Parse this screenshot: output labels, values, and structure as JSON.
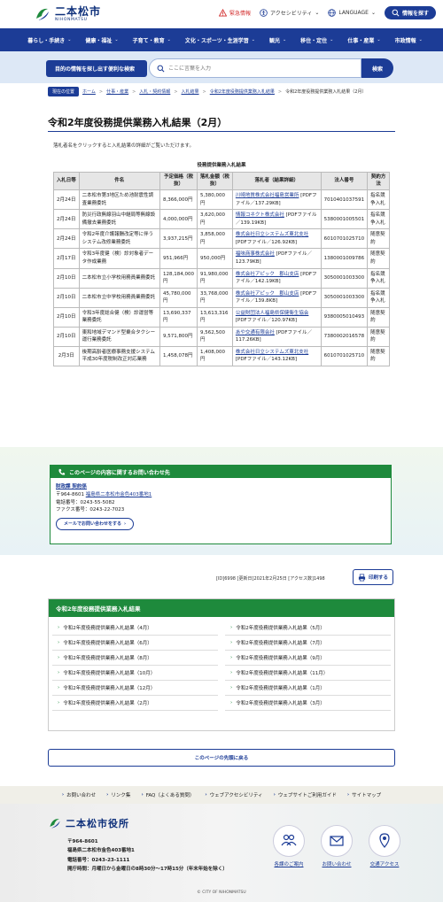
{
  "header": {
    "logo_ja": "二本松市",
    "logo_en": "NIHONMATSU",
    "emergency": "緊急情報",
    "accessibility": "アクセシビリティ",
    "language": "LANGUAGE",
    "info_search": "情報を探す"
  },
  "gnav": [
    {
      "label": "暮らし・手続き"
    },
    {
      "label": "健康・福祉"
    },
    {
      "label": "子育て・教育"
    },
    {
      "label": "文化・スポーツ・生涯学習"
    },
    {
      "label": "観光"
    },
    {
      "label": "移住・定住"
    },
    {
      "label": "仕事・産業"
    },
    {
      "label": "市政情報"
    }
  ],
  "search": {
    "label": "目的の情報を探し出す便利な検索",
    "placeholder": "ここに言葉を入力",
    "button": "検索"
  },
  "breadcrumb": {
    "here": "現在の位置",
    "items": [
      "ホーム",
      "仕事・産業",
      "入札・契約情報",
      "入札結果",
      "令和2年度役務提供業務入札結果"
    ],
    "current": "令和2年度役務提供業務入札結果（2月）"
  },
  "page": {
    "title": "令和2年度役務提供業務入札結果（2月）",
    "intro": "落札者名をクリックすると入札結果の詳細がご覧いただけます。"
  },
  "table": {
    "caption": "役務提供業務入札結果",
    "headers": [
      "入札日等",
      "件名",
      "予定価格（税抜）",
      "落札金額（税抜）",
      "落札者（結果詳細）",
      "法人番号",
      "契約方法"
    ],
    "rows": [
      {
        "date": "2月24日",
        "name": "二本松市第3地区ため池耐震性調査業務委託",
        "est": "8,366,000円",
        "bid": "5,380,000円",
        "winner": "川崎地質株式会社福島営業所",
        "file": "[PDFファイル／137.29KB]",
        "corp": "7010401037591",
        "method": "指名競争入札"
      },
      {
        "date": "2月24日",
        "name": "防災行政無線羽山中継局等無線設備撤去業務委託",
        "est": "4,000,000円",
        "bid": "3,620,000円",
        "winner": "情報コネクト株式会社",
        "file": "[PDFファイル／139.19KB]",
        "corp": "5380001005501",
        "method": "指名競争入札"
      },
      {
        "date": "2月24日",
        "name": "令和2年度介護報酬改定等に伴うシステム改修業務委託",
        "est": "3,937,215円",
        "bid": "3,858,000円",
        "winner": "株式会社日立システムズ東北支社",
        "file": "[PDFファイル／126.92KB]",
        "corp": "6010701025710",
        "method": "随意契約"
      },
      {
        "date": "2月17日",
        "name": "令和3年度健（検）診対象者データ作成業務",
        "est": "951,966円",
        "bid": "950,000円",
        "winner": "福味商事株式会社",
        "file": "[PDFファイル／123.79KB]",
        "corp": "1380001009786",
        "method": "随意契約"
      },
      {
        "date": "2月10日",
        "name": "二本松市立小学校用務員業務委託",
        "est": "128,184,000円",
        "bid": "91,980,000円",
        "winner": "株式会社アピック　郡山支店",
        "file": "[PDFファイル／142.19KB]",
        "corp": "3050001003300",
        "method": "指名競争入札"
      },
      {
        "date": "2月10日",
        "name": "二本松市立中学校用務員業務委託",
        "est": "45,780,000円",
        "bid": "33,768,000円",
        "winner": "株式会社アピック　郡山支店",
        "file": "[PDFファイル／139.8KB]",
        "corp": "3050001003300",
        "method": "指名競争入札"
      },
      {
        "date": "2月10日",
        "name": "令和3年度総合健（検）診運営等業務委託",
        "est": "13,690,337円",
        "bid": "13,613,316円",
        "winner": "公益財団法人福島県保健衛生協会",
        "file": "[PDFファイル／120.97KB]",
        "corp": "9380005010493",
        "method": "随意契約"
      },
      {
        "date": "2月10日",
        "name": "東和地域デマンド型乗合タクシー運行業務委託",
        "est": "9,571,800円",
        "bid": "9,562,500円",
        "winner": "あや交通有限会社",
        "file": "[PDFファイル／117.26KB]",
        "corp": "7380002016578",
        "method": "随意契約"
      },
      {
        "date": "2月3日",
        "name": "後期高齢者医療事務支援システム平成30年度税制改正対応業務",
        "est": "1,458,078円",
        "bid": "1,408,000円",
        "winner": "株式会社日立システムズ東北支社",
        "file": "[PDFファイル／143.12KB]",
        "corp": "6010701025710",
        "method": "随意契約"
      }
    ]
  },
  "contact": {
    "heading": "このページの内容に関するお問い合わせ先",
    "dept": "財政課 契約係",
    "postal": "〒964-8601",
    "address": "福島県二本松市金色403番地1",
    "tel": "電話番号：0243-55-5082",
    "fax": "ファクス番号：0243-22-7023",
    "mail_button": "メールでお問い合わせをする"
  },
  "meta": {
    "text": "[ID]6998 [更新日]2021年2月25日 [アクセス数]1498",
    "print": "印刷する"
  },
  "related": {
    "heading": "令和2年度役務提供業務入札結果",
    "items": [
      "令和2年度役務提供業務入札結果（4月）",
      "令和2年度役務提供業務入札結果（5月）",
      "令和2年度役務提供業務入札結果（6月）",
      "令和2年度役務提供業務入札結果（7月）",
      "令和2年度役務提供業務入札結果（8月）",
      "令和2年度役務提供業務入札結果（9月）",
      "令和2年度役務提供業務入札結果（10月）",
      "令和2年度役務提供業務入札結果（11月）",
      "令和2年度役務提供業務入札結果（12月）",
      "令和2年度役務提供業務入札結果（1月）",
      "令和2年度役務提供業務入札結果（2月）",
      "令和2年度役務提供業務入札結果（3月）"
    ]
  },
  "to_top": "このページの先頭に戻る",
  "footer_links": [
    "お問い合わせ",
    "リンク集",
    "FAQ（よくある質問）",
    "ウェブアクセシビリティ",
    "ウェブサイトご利用ガイド",
    "サイトマップ"
  ],
  "footer": {
    "office": "二本松市役所",
    "postal": "〒964-8601",
    "address": "福島県二本松市金色403番地1",
    "tel_label": "電話番号：",
    "tel": "0243-23-1111",
    "hours_label": "開庁時間：",
    "hours": "月曜日から金曜日の8時30分～17時15分（年末年始を除く）",
    "icons": [
      {
        "label": "各課のご案内",
        "icon": "people-icon"
      },
      {
        "label": "お問い合わせ",
        "icon": "mail-icon"
      },
      {
        "label": "交通アクセス",
        "icon": "map-pin-icon"
      }
    ],
    "copyright": "© CITY OF NIHONMATSU"
  },
  "colors": {
    "brand": "#1c3c96",
    "green": "#1e8a3c",
    "alert": "#d32f2f"
  }
}
